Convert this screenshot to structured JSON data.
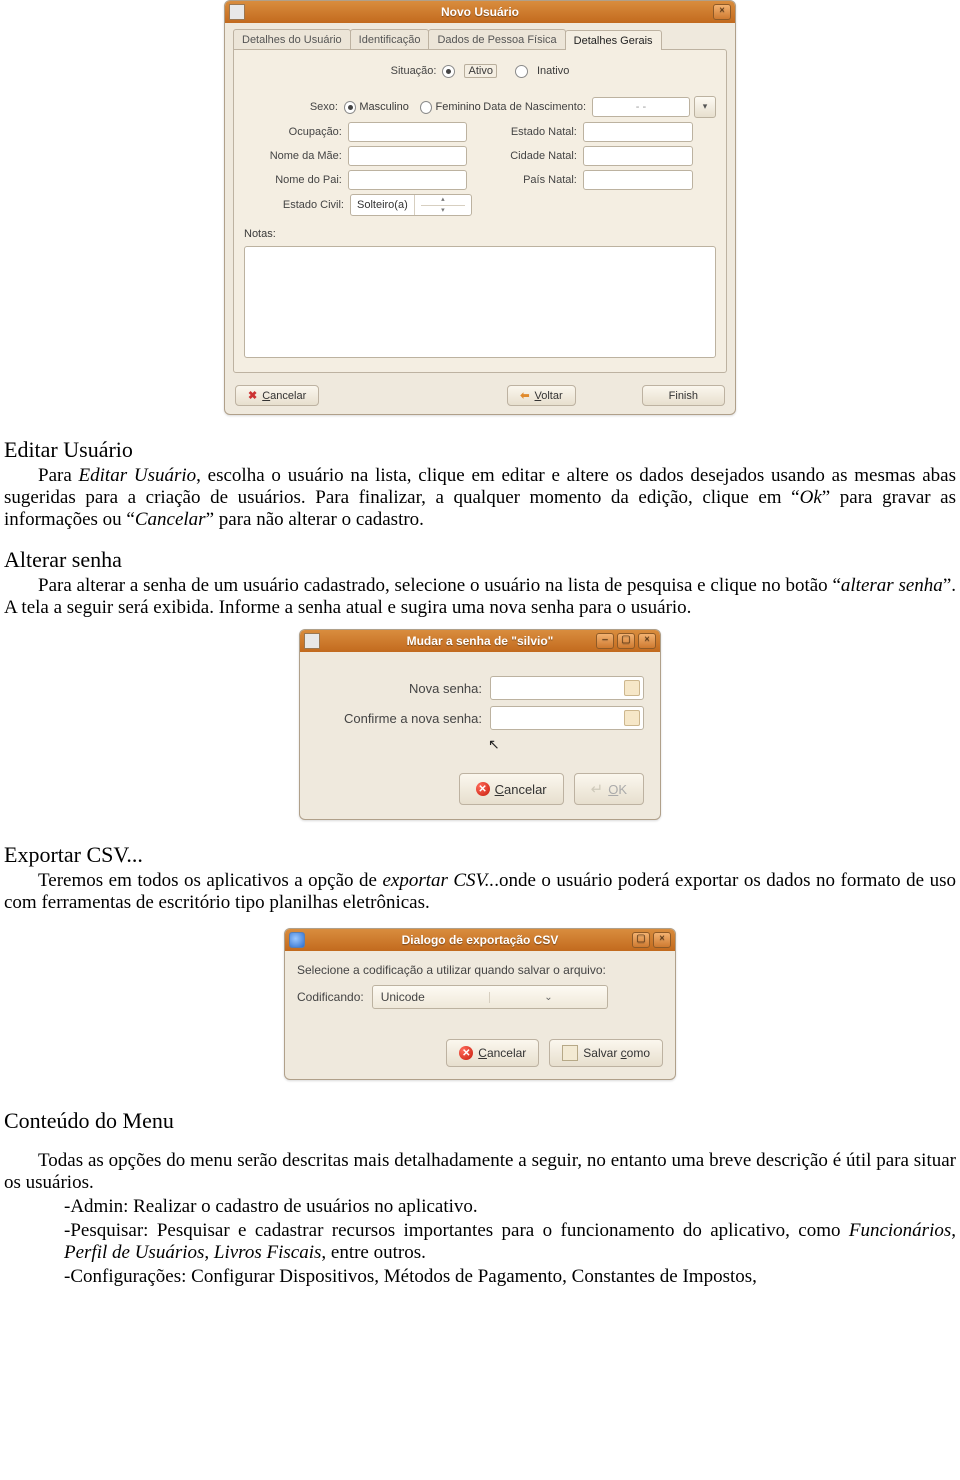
{
  "dialog1": {
    "title": "Novo Usuário",
    "tabs": [
      "Detalhes do Usuário",
      "Identificação",
      "Dados de Pessoa Física",
      "Detalhes Gerais"
    ],
    "situacao_label": "Situação:",
    "situacao_ativo": "Ativo",
    "situacao_inativo": "Inativo",
    "sexo_label": "Sexo:",
    "masculino": "Masculino",
    "feminino": "Feminino",
    "data_nasc_label": "Data de Nascimento:",
    "data_nasc_value": "-   -",
    "ocupacao_label": "Ocupação:",
    "estado_natal_label": "Estado Natal:",
    "nome_mae_label": "Nome da Mãe:",
    "cidade_natal_label": "Cidade Natal:",
    "nome_pai_label": "Nome do Pai:",
    "pais_natal_label": "País Natal:",
    "estado_civil_label": "Estado Civil:",
    "estado_civil_value": "Solteiro(a)",
    "notas_label": "Notas:",
    "cancelar": "Cancelar",
    "voltar": "Voltar",
    "finish": "Finish"
  },
  "sec_editar": {
    "heading": "Editar Usuário",
    "p1a": "Para ",
    "p1b": "Editar Usuário",
    "p1c": ", escolha o usuário na lista, clique em editar e altere os dados desejados usando as mesmas abas sugeridas para a criação de usuários. Para finalizar, a qualquer momento da edição, clique em  “",
    "p1d": "Ok",
    "p1e": "” para gravar as informações ou “",
    "p1f": "Cancelar",
    "p1g": "” para não alterar o cadastro."
  },
  "sec_senha": {
    "heading": "Alterar senha",
    "p1a": "Para alterar a senha de um usuário cadastrado, selecione o usuário na lista de pesquisa e clique no botão “",
    "p1b": "alterar  senha",
    "p1c": "”. A tela a seguir será exibida. Informe a senha atual e sugira uma nova senha para o usuário."
  },
  "dialog2": {
    "title": "Mudar a senha de \"silvio\"",
    "nova_label": "Nova senha:",
    "confirme_label": "Confirme a nova senha:",
    "cancelar": "Cancelar",
    "ok": "OK"
  },
  "sec_csv": {
    "heading": "Exportar CSV...",
    "p1a": "Teremos em todos os aplicativos a opção de ",
    "p1b": "exportar CSV..",
    "p1c": ".onde o usuário poderá exportar os dados no formato de uso com ferramentas de escritório tipo planilhas eletrônicas."
  },
  "dialog3": {
    "title": "Dialogo de exportação CSV",
    "instr": "Selecione a codificação a utilizar quando salvar o arquivo:",
    "codif_label": "Codificando:",
    "codif_value": "Unicode",
    "cancelar": "Cancelar",
    "salvar": "Salvar como"
  },
  "sec_menu": {
    "heading": "Conteúdo  do Menu",
    "intro": "Todas as opções do menu serão descritas mais detalhadamente a seguir, no entanto uma breve descrição é útil para situar os usuários.",
    "admin": "-Admin:  Realizar o cadastro de usuários no aplicativo.",
    "pesq_a": "-Pesquisar:  Pesquisar e cadastrar recursos importantes para o funcionamento do aplicativo, como ",
    "pesq_i1": "Funcionários",
    "pesq_s1": ", ",
    "pesq_i2": "Perfil de Usuários",
    "pesq_s2": ", ",
    "pesq_i3": "Livros Fiscais",
    "pesq_b": ", entre outros.",
    "conf": "-Configurações: Configurar Dispositivos, Métodos de Pagamento, Constantes de Impostos,"
  }
}
